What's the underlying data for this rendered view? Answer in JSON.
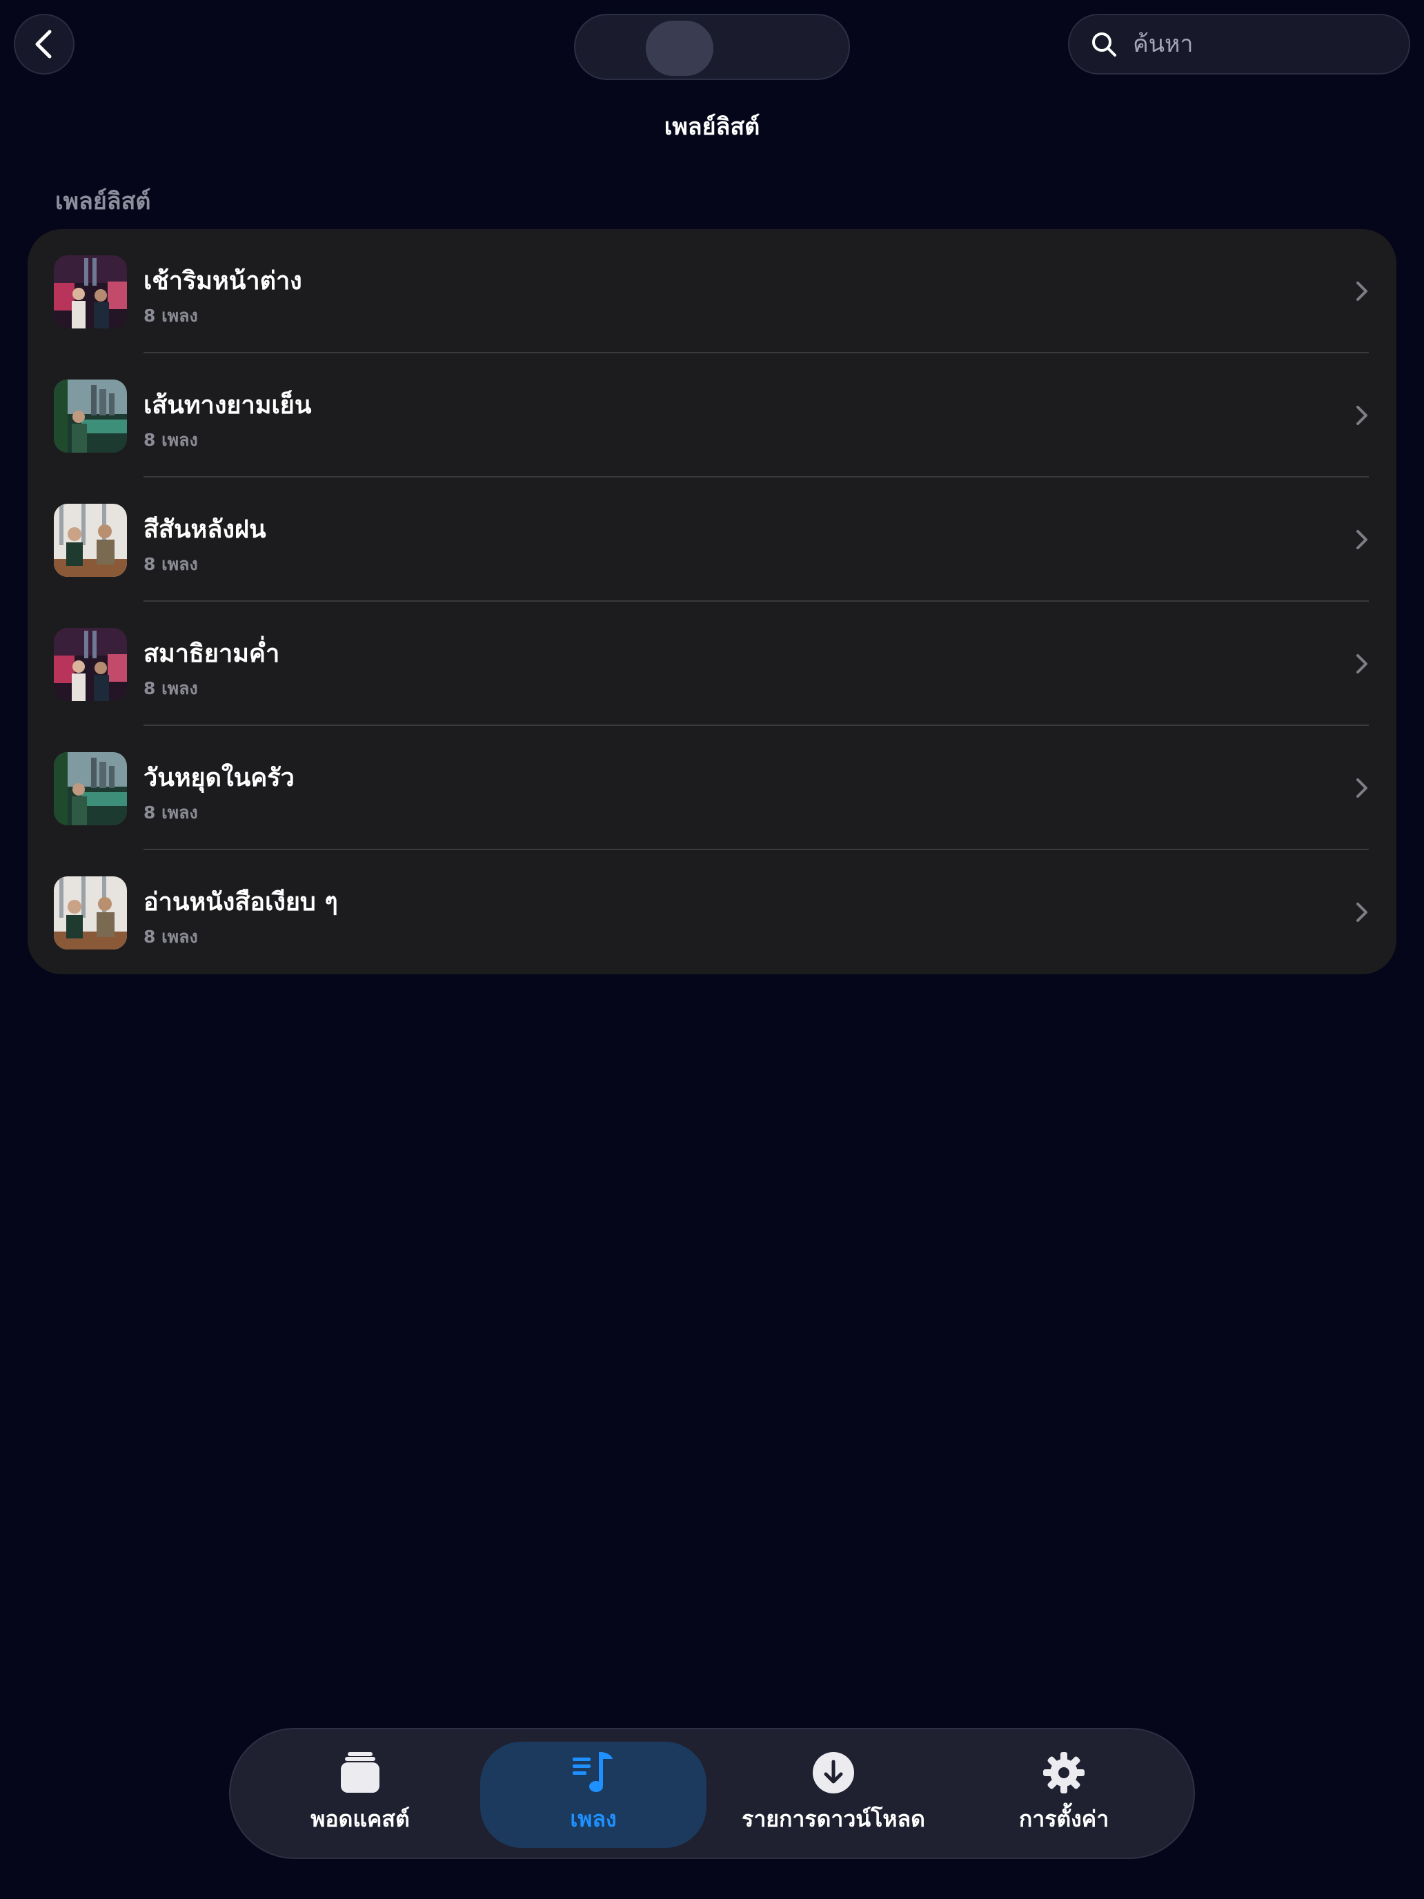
{
  "header": {
    "back_icon": "chevron-left-icon",
    "search": {
      "placeholder": "ค้นหา",
      "icon": "search-icon"
    },
    "page_title": "เพลย์ลิสต์"
  },
  "section": {
    "header": "เพลย์ลิสต์"
  },
  "playlists": [
    {
      "title": "เช้าริมหน้าต่าง",
      "subtitle": "8 เพลง",
      "thumb": "city-night-couple"
    },
    {
      "title": "เส้นทางยามเย็น",
      "subtitle": "8 เพลง",
      "thumb": "skyline-balcony"
    },
    {
      "title": "สีสันหลังฝน",
      "subtitle": "8 เพลง",
      "thumb": "cafe-duo"
    },
    {
      "title": "สมาธิยามค่ำ",
      "subtitle": "8 เพลง",
      "thumb": "city-night-couple"
    },
    {
      "title": "วันหยุดในครัว",
      "subtitle": "8 เพลง",
      "thumb": "skyline-balcony"
    },
    {
      "title": "อ่านหนังสือเงียบ ๆ",
      "subtitle": "8 เพลง",
      "thumb": "cafe-duo"
    }
  ],
  "tabs": [
    {
      "label": "พอดแคสต์",
      "icon": "podcast-stack-icon",
      "active": false
    },
    {
      "label": "เพลง",
      "icon": "music-list-icon",
      "active": true
    },
    {
      "label": "รายการดาวน์โหลด",
      "icon": "download-circle-icon",
      "active": false
    },
    {
      "label": "การตั้งค่า",
      "icon": "gear-icon",
      "active": false
    }
  ],
  "colors": {
    "accent": "#1e90ff",
    "background": "#05061a",
    "card": "#1c1c1e"
  }
}
